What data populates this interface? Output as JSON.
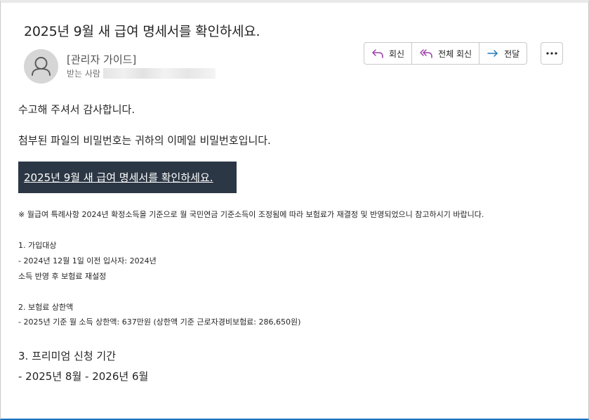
{
  "email": {
    "subject": "2025년 9월 새 급여 명세서를 확인하세요.",
    "sender": "[관리자 가이드]",
    "recipient_label": "받는 사람"
  },
  "actions": {
    "reply": "회신",
    "reply_all": "전체 회신",
    "forward": "전달"
  },
  "body": {
    "thanks": "수고해 주셔서 감사합니다.",
    "password_note": "첨부된 파일의 비밀번호는 귀하의 이메일 비밀번호입니다.",
    "cta_link": "2025년 9월 새 급여 명세서를 확인하세요.",
    "notice": "※  월급여 특례사항 2024년 확정소득을 기준으로 월 국민연금 기준소득이 조정됨에 따라 보험료가 재결정 및 반영되었으니 참고하시기 바랍니다.",
    "section1_title": "1. 가입대상",
    "section1_line1": "- 2024년 12월 1일 이전 입사자: 2024년",
    "section1_line2": "소득 반영 후 보험료 재설정",
    "section2_title": "2. 보험료 상한액",
    "section2_line1": "- 2025년 기준 월 소득 상한액: 637만원 (상한액 기준 근로자경비보험료: 286,650원)",
    "section3_title": "3. 프리미엄 신청 기간",
    "section3_line1": "- 2025년 8월 - 2026년 6월"
  },
  "icons": {
    "reply": "reply-icon",
    "reply_all": "reply-all-icon",
    "forward": "forward-icon",
    "more": "more-icon",
    "avatar": "person-icon"
  },
  "colors": {
    "cta_background": "#2c3745",
    "reply_icon": "#9b3fa8",
    "forward_icon": "#1f7ab8"
  }
}
